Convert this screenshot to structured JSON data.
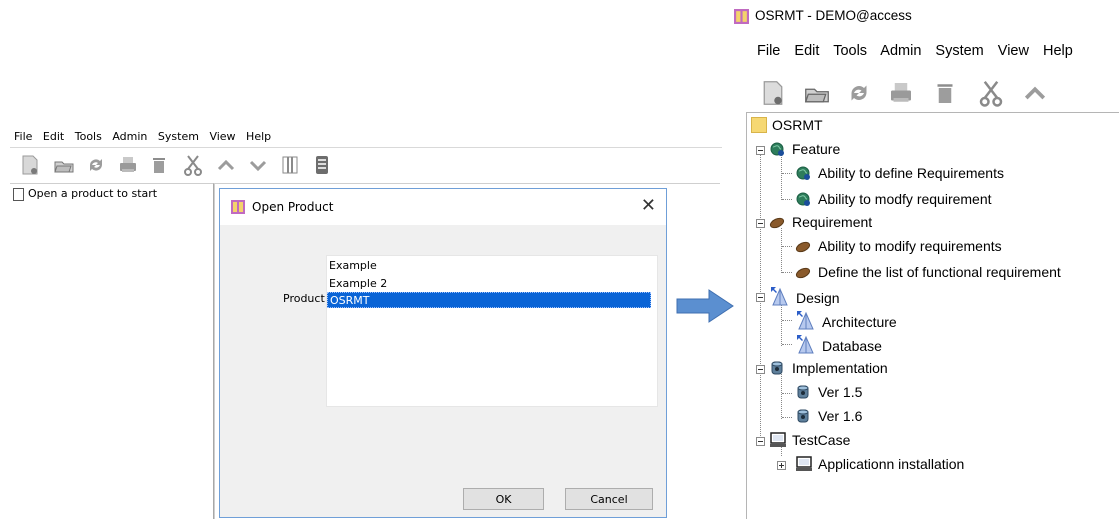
{
  "left_window": {
    "menu": [
      "File",
      "Edit",
      "Tools",
      "Admin",
      "System",
      "View",
      "Help"
    ],
    "toolbar_icons": [
      "new-document-icon",
      "open-folder-icon",
      "refresh-icon",
      "print-icon",
      "delete-icon",
      "cut-icon",
      "move-up-icon",
      "move-down-icon",
      "columns-icon",
      "report-icon"
    ],
    "tree_placeholder": "Open a product to start"
  },
  "dialog": {
    "title": "Open Product",
    "close_glyph": "✕",
    "product_label": "Product",
    "products": [
      "Example",
      "Example 2",
      "OSRMT"
    ],
    "selected": "OSRMT",
    "ok_label": "OK",
    "cancel_label": "Cancel"
  },
  "right_window": {
    "title": "OSRMT - DEMO@access",
    "menu": [
      "File",
      "Edit",
      "Tools",
      "Admin",
      "System",
      "View",
      "Help"
    ],
    "toolbar_icons": [
      "new-document-icon",
      "open-folder-icon",
      "refresh-icon",
      "print-icon",
      "delete-icon",
      "cut-icon",
      "move-up-icon"
    ],
    "tree": {
      "root": "OSRMT",
      "feature": "Feature",
      "feature_items": [
        "Ability to define Requirements",
        "Ability to modfy requirement"
      ],
      "requirement": "Requirement",
      "requirement_items": [
        "Ability to modify requirements",
        "Define the list of functional requirement"
      ],
      "design": "Design",
      "design_items": [
        "Architecture",
        "Database"
      ],
      "implementation": "Implementation",
      "implementation_items": [
        "Ver 1.5",
        "Ver 1.6"
      ],
      "testcase": "TestCase",
      "testcase_items": [
        "Applicationn installation"
      ]
    }
  },
  "colors": {
    "selection": "#0a64d6",
    "arrow": "#5b8fd0",
    "dialog_border": "#6f9fd8"
  }
}
